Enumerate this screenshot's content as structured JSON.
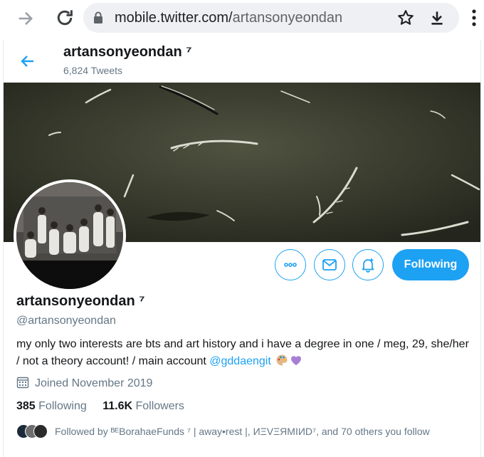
{
  "browser": {
    "url_host": "mobile.twitter.com/",
    "url_path": "artansonyeondan"
  },
  "header": {
    "display_name": "artansonyeondan ⁷",
    "tweet_count": "6,824 Tweets"
  },
  "profile": {
    "display_name": "artansonyeondan ⁷",
    "handle": "@artansonyeondan",
    "bio_text": "my only two interests are bts and art history and i have a degree in one / meg, 29, she/her / not a theory account! / main account ",
    "bio_mention": "@gddaengit",
    "joined": "Joined November 2019",
    "following_count": "385",
    "following_label": "Following",
    "followers_count": "11.6K",
    "followers_label": "Followers",
    "followed_by": "Followed by ᴮᴱBorahaeFunds ⁷ | away•rest |, ИΞVΞЯMIИD⁷, and 70 others you follow"
  },
  "actions": {
    "follow_label": "Following"
  },
  "colors": {
    "accent": "#1da1f2",
    "secondary_text": "#657786",
    "banner": "#35372b"
  },
  "icons": [
    "forward-arrow-icon",
    "reload-icon",
    "lock-icon",
    "star-icon",
    "download-icon",
    "overflow-menu-icon",
    "back-arrow-icon",
    "more-icon",
    "message-icon",
    "notification-bell-icon",
    "calendar-icon",
    "palette-emoji",
    "purple-heart-emoji"
  ]
}
